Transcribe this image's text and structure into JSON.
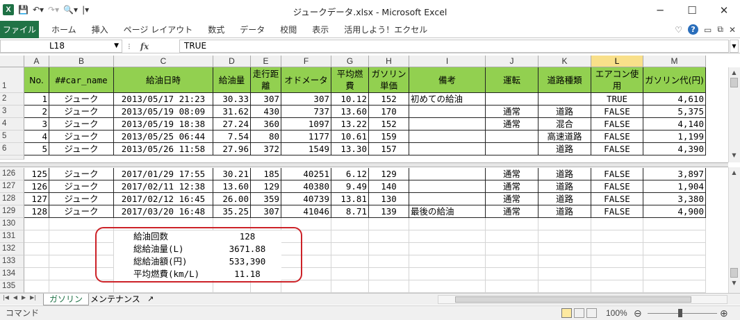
{
  "window": {
    "title": "ジュークデータ.xlsx - Microsoft Excel",
    "app_icon": "X",
    "minimize": "─",
    "maximize": "☐",
    "close": "✕"
  },
  "ribbon": {
    "file_tab": "ファイル",
    "tabs": [
      "ホーム",
      "挿入",
      "ページ レイアウト",
      "数式",
      "データ",
      "校閲",
      "表示",
      "活用しよう！エクセル"
    ]
  },
  "formula_bar": {
    "name_box": "L18",
    "fx": "fx",
    "content": "TRUE"
  },
  "columns": [
    "A",
    "B",
    "C",
    "D",
    "E",
    "F",
    "G",
    "H",
    "I",
    "J",
    "K",
    "L",
    "M"
  ],
  "selected_column": "L",
  "header_row": {
    "row": "1",
    "cells": [
      "No.",
      "##car_name",
      "給油日時",
      "給油量",
      "走行距離",
      "オドメータ",
      "平均燃費",
      "ガソリン単価",
      "備考",
      "運転",
      "道路種類",
      "エアコン使用",
      "ガソリン代(円)"
    ]
  },
  "rows_top": [
    {
      "row": "2",
      "cells": [
        "1",
        "ジューク",
        "2013/05/17 21:23",
        "30.33",
        "307",
        "307",
        "10.12",
        "152",
        "初めての給油",
        "",
        "",
        "TRUE",
        "4,610"
      ]
    },
    {
      "row": "3",
      "cells": [
        "2",
        "ジューク",
        "2013/05/19 08:09",
        "31.62",
        "430",
        "737",
        "13.60",
        "170",
        "",
        "通常",
        "道路",
        "FALSE",
        "5,375"
      ]
    },
    {
      "row": "4",
      "cells": [
        "3",
        "ジューク",
        "2013/05/19 18:38",
        "27.24",
        "360",
        "1097",
        "13.22",
        "152",
        "",
        "通常",
        "混合",
        "FALSE",
        "4,140"
      ]
    },
    {
      "row": "5",
      "cells": [
        "4",
        "ジューク",
        "2013/05/25 06:44",
        "7.54",
        "80",
        "1177",
        "10.61",
        "159",
        "",
        "",
        "高速道路",
        "FALSE",
        "1,199"
      ]
    },
    {
      "row": "6",
      "cells": [
        "5",
        "ジューク",
        "2013/05/26 11:58",
        "27.96",
        "372",
        "1549",
        "13.30",
        "157",
        "",
        "",
        "道路",
        "FALSE",
        "4,390"
      ]
    }
  ],
  "rows_bottom": [
    {
      "row": "126",
      "cells": [
        "125",
        "ジューク",
        "2017/01/29 17:55",
        "30.21",
        "185",
        "40251",
        "6.12",
        "129",
        "",
        "通常",
        "道路",
        "FALSE",
        "3,897"
      ]
    },
    {
      "row": "127",
      "cells": [
        "126",
        "ジューク",
        "2017/02/11 12:38",
        "13.60",
        "129",
        "40380",
        "9.49",
        "140",
        "",
        "通常",
        "道路",
        "FALSE",
        "1,904"
      ]
    },
    {
      "row": "128",
      "cells": [
        "127",
        "ジューク",
        "2017/02/12 16:45",
        "26.00",
        "359",
        "40739",
        "13.81",
        "130",
        "",
        "通常",
        "道路",
        "FALSE",
        "3,380"
      ]
    },
    {
      "row": "129",
      "cells": [
        "128",
        "ジューク",
        "2017/03/20 16:48",
        "35.25",
        "307",
        "41046",
        "8.71",
        "139",
        "最後の給油",
        "通常",
        "道路",
        "FALSE",
        "4,900"
      ]
    }
  ],
  "summary": [
    {
      "row": "131",
      "label": "給油回数",
      "value": "128"
    },
    {
      "row": "132",
      "label": "総給油量(L)",
      "value": "3671.88"
    },
    {
      "row": "133",
      "label": "総給油額(円)",
      "value": "533,390"
    },
    {
      "row": "134",
      "label": "平均燃費(km/L)",
      "value": "11.18"
    }
  ],
  "empty_rows": [
    "130",
    "135"
  ],
  "sheets": [
    "ガソリン",
    "メンテナンス"
  ],
  "active_sheet": "ガソリン",
  "status": {
    "mode": "コマンド",
    "zoom": "100%"
  },
  "colors": {
    "header_fill": "#92d050",
    "file_tab": "#207346",
    "highlight_border": "#cc2127",
    "selected_col": "#f9e08a"
  }
}
